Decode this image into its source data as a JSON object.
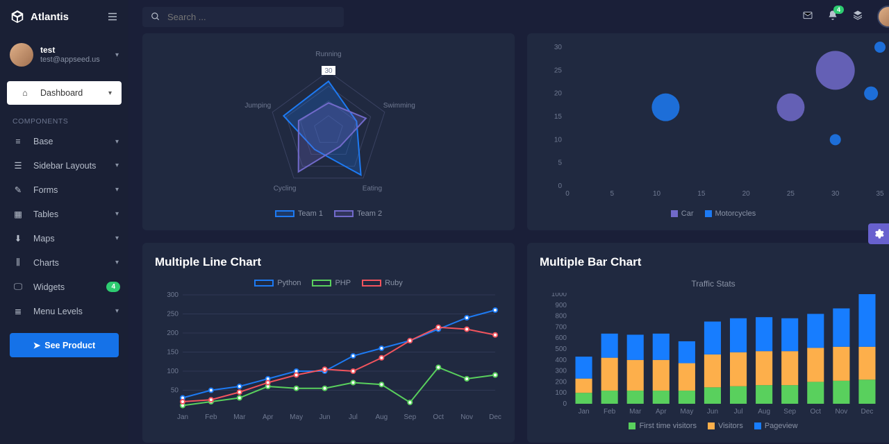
{
  "app_name": "Atlantis",
  "search": {
    "placeholder": "Search ..."
  },
  "user": {
    "name": "test",
    "email": "test@appseed.us"
  },
  "notif_count": "4",
  "sidebar": {
    "dashboard": "Dashboard",
    "section": "COMPONENTS",
    "items": [
      {
        "icon": "layers",
        "label": "Base",
        "caret": true
      },
      {
        "icon": "list",
        "label": "Sidebar Layouts",
        "caret": true
      },
      {
        "icon": "pencil",
        "label": "Forms",
        "caret": true
      },
      {
        "icon": "table",
        "label": "Tables",
        "caret": true
      },
      {
        "icon": "pin",
        "label": "Maps",
        "caret": true
      },
      {
        "icon": "bars",
        "label": "Charts",
        "caret": true
      },
      {
        "icon": "desktop",
        "label": "Widgets",
        "badge": "4"
      },
      {
        "icon": "menu",
        "label": "Menu Levels",
        "caret": true
      }
    ],
    "product_btn": "See Product"
  },
  "titles": {
    "line": "Multiple Line Chart",
    "bar": "Multiple Bar Chart",
    "traffic": "Traffic Stats"
  },
  "chart_data": [
    {
      "type": "radar",
      "categories": [
        "Running",
        "Swimming",
        "Eating",
        "Cycling",
        "Jumping"
      ],
      "series": [
        {
          "name": "Team 1",
          "values": [
            25,
            15,
            28,
            12,
            24
          ],
          "color": "#1d7af3"
        },
        {
          "name": "Team 2",
          "values": [
            14,
            20,
            10,
            26,
            16
          ],
          "color": "#716aca"
        }
      ],
      "ticks": [
        30,
        null,
        null
      ],
      "max": 30
    },
    {
      "type": "bubble",
      "xlim": [
        0,
        35
      ],
      "ylim": [
        0,
        30
      ],
      "xticks": [
        0,
        5,
        10,
        15,
        20,
        25,
        30,
        35
      ],
      "yticks": [
        0,
        5,
        10,
        15,
        20,
        25,
        30
      ],
      "series": [
        {
          "name": "Car",
          "color": "#716aca",
          "points": [
            {
              "x": 25,
              "y": 17,
              "r": 10
            },
            {
              "x": 30,
              "y": 25,
              "r": 14
            }
          ]
        },
        {
          "name": "Motorcycles",
          "color": "#1d7af3",
          "points": [
            {
              "x": 11,
              "y": 17,
              "r": 10
            },
            {
              "x": 30,
              "y": 10,
              "r": 4
            },
            {
              "x": 34,
              "y": 20,
              "r": 5
            },
            {
              "x": 35,
              "y": 30,
              "r": 4
            }
          ]
        }
      ]
    },
    {
      "type": "line",
      "categories": [
        "Jan",
        "Feb",
        "Mar",
        "Apr",
        "May",
        "Jun",
        "Jul",
        "Aug",
        "Sep",
        "Oct",
        "Nov",
        "Dec"
      ],
      "ylim": [
        0,
        300
      ],
      "yticks": [
        50,
        100,
        150,
        200,
        250,
        300
      ],
      "series": [
        {
          "name": "Python",
          "color": "#1d7af3",
          "values": [
            30,
            50,
            60,
            80,
            100,
            100,
            140,
            160,
            180,
            210,
            240,
            260
          ]
        },
        {
          "name": "PHP",
          "color": "#59d05d",
          "values": [
            10,
            20,
            30,
            60,
            55,
            55,
            70,
            65,
            18,
            110,
            80,
            90
          ]
        },
        {
          "name": "Ruby",
          "color": "#f3545d",
          "values": [
            20,
            25,
            45,
            70,
            90,
            105,
            100,
            135,
            180,
            215,
            210,
            195
          ]
        }
      ]
    },
    {
      "type": "bar",
      "title": "Traffic Stats",
      "categories": [
        "Jan",
        "Feb",
        "Mar",
        "Apr",
        "May",
        "Jun",
        "Jul",
        "Aug",
        "Sep",
        "Oct",
        "Nov",
        "Dec"
      ],
      "ylim": [
        0,
        1000
      ],
      "yticks": [
        0,
        100,
        200,
        300,
        400,
        500,
        600,
        700,
        800,
        900,
        1000
      ],
      "series": [
        {
          "name": "First time visitors",
          "color": "#59d05d",
          "values": [
            100,
            120,
            120,
            120,
            120,
            150,
            160,
            170,
            170,
            200,
            210,
            220
          ]
        },
        {
          "name": "Visitors",
          "color": "#fdaf4b",
          "values": [
            130,
            300,
            280,
            280,
            250,
            300,
            310,
            310,
            310,
            310,
            310,
            300
          ]
        },
        {
          "name": "Pageview",
          "color": "#177dff",
          "values": [
            200,
            220,
            230,
            240,
            200,
            300,
            310,
            310,
            300,
            310,
            350,
            480
          ]
        }
      ]
    }
  ]
}
